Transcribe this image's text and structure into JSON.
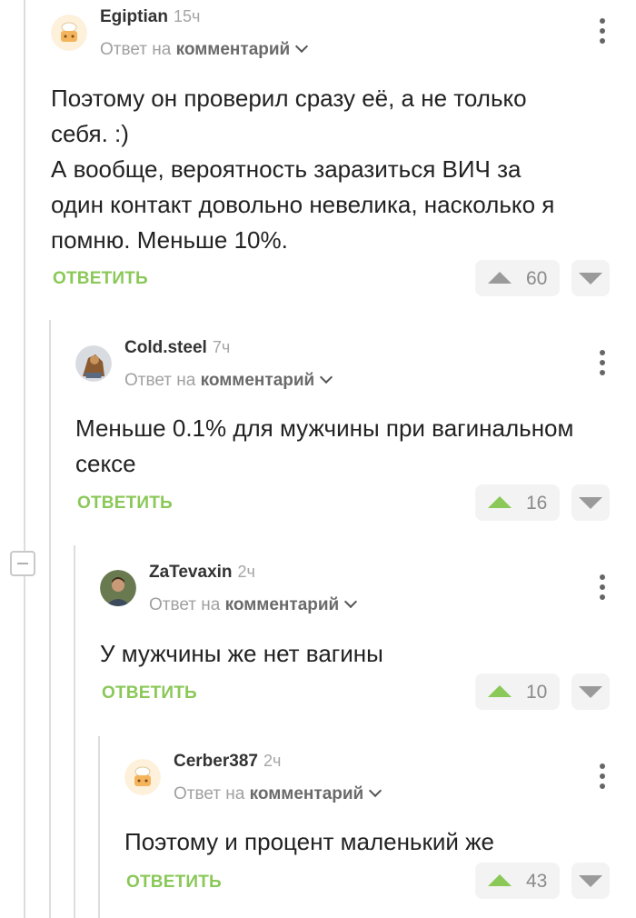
{
  "comments": [
    {
      "author": "Egiptian",
      "time": "15ч",
      "reply_prefix": "Ответ на",
      "reply_target": "комментарий",
      "lines": [
        "Поэтому он проверил сразу её, а не только",
        "себя. :)",
        "А вообще, вероятность заразиться ВИЧ за",
        "один контакт довольно невелика, насколько я",
        "помню. Меньше 10%."
      ],
      "reply_label": "ОТВЕТИТЬ",
      "votes": "60",
      "upvoted": false,
      "avatar": "chef-avatar-icon"
    },
    {
      "author": "Cold.steel",
      "time": "7ч",
      "reply_prefix": "Ответ на",
      "reply_target": "комментарий",
      "lines": [
        "Меньше 0.1% для мужчины при вагинальном",
        "сексе"
      ],
      "reply_label": "ОТВЕТИТЬ",
      "votes": "16",
      "upvoted": true,
      "avatar": "user-photo-avatar"
    },
    {
      "author": "ZaTevaxin",
      "time": "2ч",
      "reply_prefix": "Ответ на",
      "reply_target": "комментарий",
      "lines": [
        "У мужчины же нет вагины"
      ],
      "reply_label": "ОТВЕТИТЬ",
      "votes": "10",
      "upvoted": true,
      "avatar": "user-photo-avatar"
    },
    {
      "author": "Cerber387",
      "time": "2ч",
      "reply_prefix": "Ответ на",
      "reply_target": "комментарий",
      "lines": [
        "Поэтому и процент маленький же"
      ],
      "reply_label": "ОТВЕТИТЬ",
      "votes": "43",
      "upvoted": true,
      "avatar": "chef-avatar-icon"
    }
  ],
  "colors": {
    "accent_green": "#8ac858",
    "text": "#222222",
    "muted": "#a0a0a0",
    "vote_bg": "#f3f3f3"
  }
}
